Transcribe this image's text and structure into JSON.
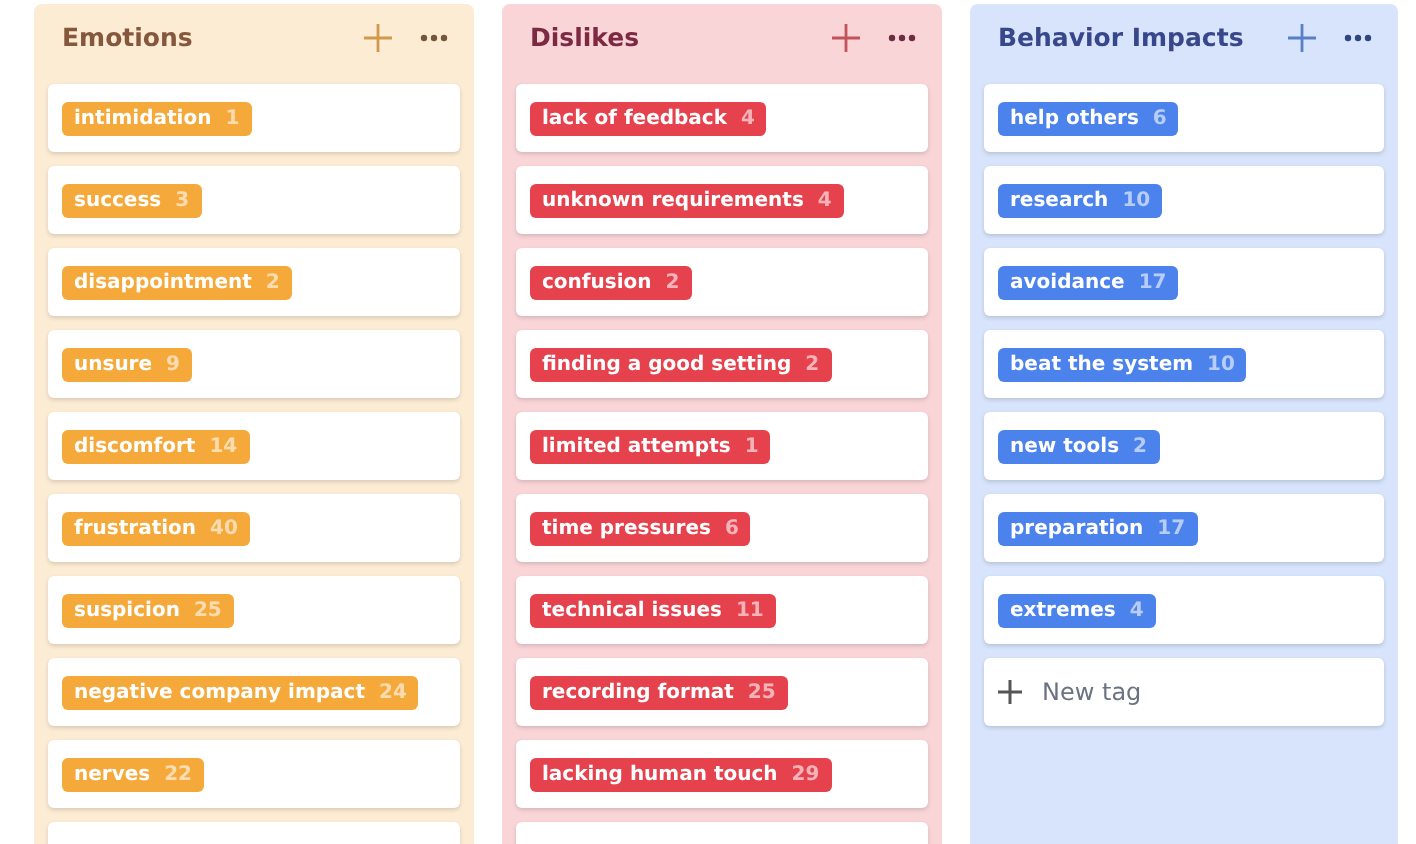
{
  "columns": [
    {
      "title": "Emotions",
      "color": "#f6a93b",
      "more_below": true,
      "tags": [
        {
          "label": "intimidation",
          "count": "1"
        },
        {
          "label": "success",
          "count": "3"
        },
        {
          "label": "disappointment",
          "count": "2"
        },
        {
          "label": "unsure",
          "count": "9"
        },
        {
          "label": "discomfort",
          "count": "14"
        },
        {
          "label": "frustration",
          "count": "40"
        },
        {
          "label": "suspicion",
          "count": "25"
        },
        {
          "label": "negative company impact",
          "count": "24"
        },
        {
          "label": "nerves",
          "count": "22"
        }
      ]
    },
    {
      "title": "Dislikes",
      "color": "#e5424d",
      "more_below": true,
      "tags": [
        {
          "label": "lack of feedback",
          "count": "4"
        },
        {
          "label": "unknown requirements",
          "count": "4"
        },
        {
          "label": "confusion",
          "count": "2"
        },
        {
          "label": "finding a good setting",
          "count": "2"
        },
        {
          "label": "limited attempts",
          "count": "1"
        },
        {
          "label": "time pressures",
          "count": "6"
        },
        {
          "label": "technical issues",
          "count": "11"
        },
        {
          "label": "recording format",
          "count": "25"
        },
        {
          "label": "lacking human touch",
          "count": "29"
        }
      ]
    },
    {
      "title": "Behavior Impacts",
      "color": "#4b82ec",
      "more_below": false,
      "new_tag": "New tag",
      "tags": [
        {
          "label": "help others",
          "count": "6"
        },
        {
          "label": "research",
          "count": "10"
        },
        {
          "label": "avoidance",
          "count": "17"
        },
        {
          "label": "beat the system",
          "count": "10"
        },
        {
          "label": "new tools",
          "count": "2"
        },
        {
          "label": "preparation",
          "count": "17"
        },
        {
          "label": "extremes",
          "count": "4"
        }
      ]
    }
  ]
}
